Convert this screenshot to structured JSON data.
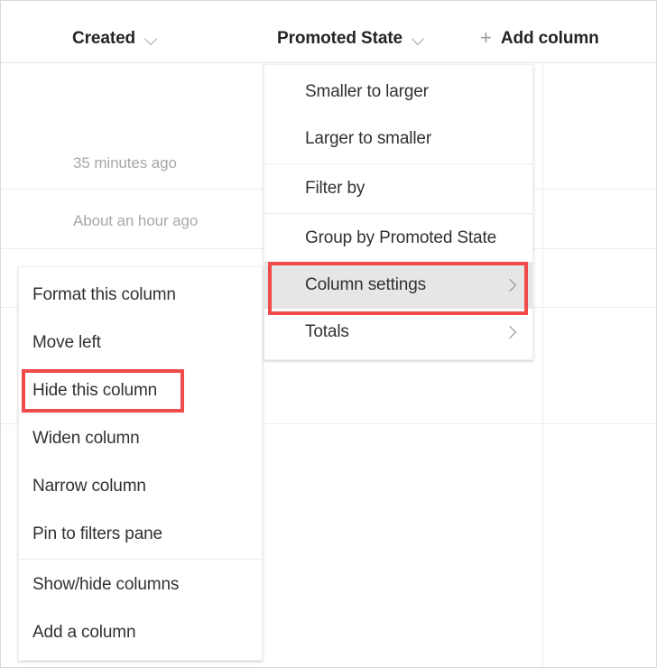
{
  "header": {
    "columns": [
      {
        "label": "Created",
        "icon": "chevron-down-icon"
      },
      {
        "label": "Promoted State",
        "icon": "chevron-down-icon"
      }
    ],
    "add_column": {
      "label": "Add column",
      "icon": "plus-icon"
    }
  },
  "grid": {
    "cells": [
      {
        "text": "35 minutes ago"
      },
      {
        "text": "About an hour ago"
      }
    ]
  },
  "promoted_state_menu": {
    "items": [
      {
        "label": "Smaller to larger",
        "submenu": false,
        "selected": false
      },
      {
        "label": "Larger to smaller",
        "submenu": false,
        "selected": false
      },
      {
        "label": "Filter by",
        "submenu": false,
        "selected": false
      },
      {
        "label": "Group by Promoted State",
        "submenu": false,
        "selected": false
      },
      {
        "label": "Column settings",
        "submenu": true,
        "selected": true
      },
      {
        "label": "Totals",
        "submenu": true,
        "selected": false
      }
    ]
  },
  "column_settings_menu": {
    "items": [
      {
        "label": "Format this column"
      },
      {
        "label": "Move left"
      },
      {
        "label": "Hide this column"
      },
      {
        "label": "Widen column"
      },
      {
        "label": "Narrow column"
      },
      {
        "label": "Pin to filters pane"
      },
      {
        "label": "Show/hide columns"
      },
      {
        "label": "Add a column"
      }
    ]
  },
  "annotations": {
    "color": "#f04a4a",
    "boxes": [
      {
        "target": "Column settings"
      },
      {
        "target": "Hide this column"
      }
    ]
  }
}
